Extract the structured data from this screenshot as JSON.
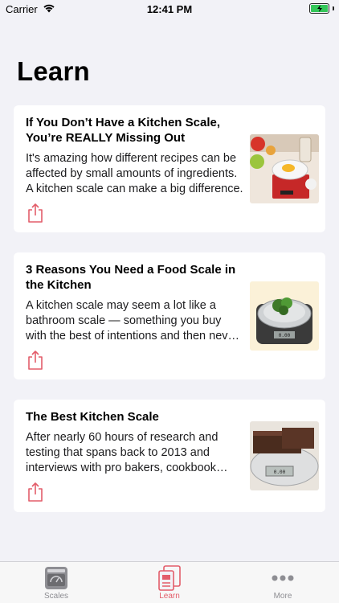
{
  "status_bar": {
    "carrier": "Carrier",
    "time": "12:41 PM",
    "battery_color": "#34c759"
  },
  "page": {
    "title": "Learn"
  },
  "articles": [
    {
      "title": "If You Don’t Have a Kitchen Scale, You’re REALLY Missing Out",
      "excerpt": "It's amazing how different recipes can be affected by small amounts of ingredients. A kitchen scale can make a big difference.",
      "image_icon": "kitchen-scale-with-eggs-photo"
    },
    {
      "title": "3 Reasons You Need a Food Scale in the Kitchen",
      "excerpt": "A kitchen scale may seem a lot like a bathroom scale — something you buy with the best of intentions and then never use.",
      "image_icon": "food-scale-with-greens-photo"
    },
    {
      "title": "The Best Kitchen Scale",
      "excerpt": "After nearly 60 hours of research and testing that spans back to 2013 and interviews with pro bakers, cookbook authors and more.",
      "image_icon": "scale-with-chocolate-photo"
    }
  ],
  "tabs": [
    {
      "label": "Scales",
      "icon": "scale-icon",
      "active": false
    },
    {
      "label": "Learn",
      "icon": "document-icon",
      "active": true
    },
    {
      "label": "More",
      "icon": "ellipsis-icon",
      "active": false
    }
  ],
  "colors": {
    "accent": "#e35d6a",
    "background": "#f2f2f7",
    "inactive_tab": "#8e8e93"
  }
}
